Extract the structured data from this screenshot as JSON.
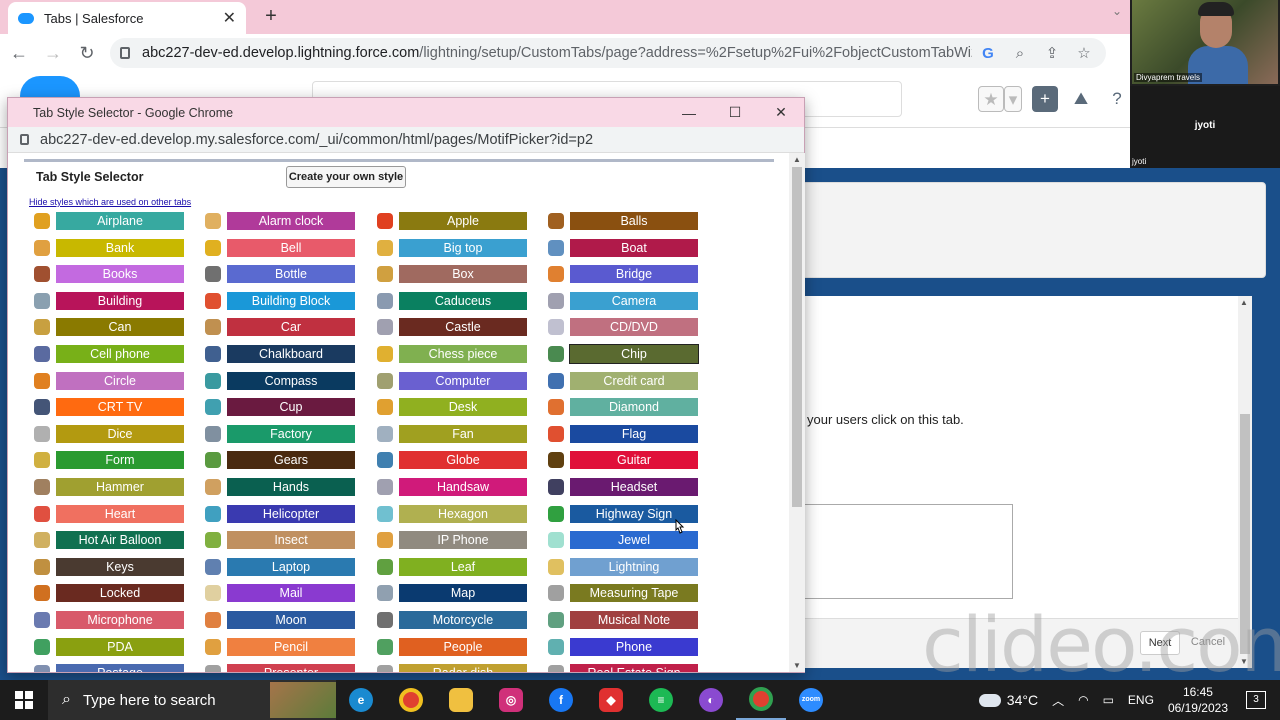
{
  "main_browser": {
    "tab_title": "Tabs | Salesforce",
    "url_host": "abc227-dev-ed.develop.lightning.force.com",
    "url_path": "/lightning/setup/CustomTabs/page?address=%2Fsetup%2Fui%2FobjectCustomTabWizard..."
  },
  "salesforce_page": {
    "help_text": "your users click on this tab.",
    "next_label": "Next",
    "cancel_label": "Cancel"
  },
  "zoom": {
    "participant_1": "Divyaprem travels",
    "participant_2": "jyoti",
    "participant_2_label": "jyoti"
  },
  "popup": {
    "window_title": "Tab Style Selector - Google Chrome",
    "url": "abc227-dev-ed.develop.my.salesforce.com/_ui/common/html/pages/MotifPicker?id=p2",
    "heading": "Tab Style Selector",
    "create_button": "Create your own style",
    "hide_link": "Hide styles which are used on other tabs",
    "selected_style": "Chip",
    "columns": [
      [
        {
          "label": "Airplane",
          "color": "#37a9a0",
          "icon_color": "#e0a020"
        },
        {
          "label": "Bank",
          "color": "#c8b800",
          "icon_color": "#e0a040"
        },
        {
          "label": "Books",
          "color": "#c36ae0",
          "icon_color": "#a05030"
        },
        {
          "label": "Building",
          "color": "#b8145a",
          "icon_color": "#8aa0b0"
        },
        {
          "label": "Can",
          "color": "#8a7a00",
          "icon_color": "#c8a040"
        },
        {
          "label": "Cell phone",
          "color": "#78b018",
          "icon_color": "#5a6aa0"
        },
        {
          "label": "Circle",
          "color": "#c070c0",
          "icon_color": "#e08020"
        },
        {
          "label": "CRT TV",
          "color": "#ff6a10",
          "icon_color": "#445577"
        },
        {
          "label": "Dice",
          "color": "#b39a10",
          "icon_color": "#b0b0b0"
        },
        {
          "label": "Form",
          "color": "#2a9a30",
          "icon_color": "#d0b040"
        },
        {
          "label": "Hammer",
          "color": "#a0a030",
          "icon_color": "#a08060"
        },
        {
          "label": "Heart",
          "color": "#f07060",
          "icon_color": "#e05040"
        },
        {
          "label": "Hot Air Balloon",
          "color": "#107050",
          "icon_color": "#d0b060"
        },
        {
          "label": "Keys",
          "color": "#4a3a30",
          "icon_color": "#c09040"
        },
        {
          "label": "Locked",
          "color": "#6a2a20",
          "icon_color": "#d07020"
        },
        {
          "label": "Microphone",
          "color": "#d85a6a",
          "icon_color": "#6a7ab0"
        },
        {
          "label": "PDA",
          "color": "#8aa010",
          "icon_color": "#40a060"
        },
        {
          "label": "Postage",
          "color": "#4a6ab0",
          "icon_color": "#8090b0"
        }
      ],
      [
        {
          "label": "Alarm clock",
          "color": "#b03a9a",
          "icon_color": "#e0b060"
        },
        {
          "label": "Bell",
          "color": "#e85a6a",
          "icon_color": "#e0b020"
        },
        {
          "label": "Bottle",
          "color": "#5a6ad0",
          "icon_color": "#707070"
        },
        {
          "label": "Building Block",
          "color": "#1a98d8",
          "icon_color": "#e05030"
        },
        {
          "label": "Car",
          "color": "#c03040",
          "icon_color": "#c09050"
        },
        {
          "label": "Chalkboard",
          "color": "#1a3a60",
          "icon_color": "#406090"
        },
        {
          "label": "Compass",
          "color": "#0a3a60",
          "icon_color": "#3a9aa0"
        },
        {
          "label": "Cup",
          "color": "#6a1a40",
          "icon_color": "#40a0b0"
        },
        {
          "label": "Factory",
          "color": "#1a9a6a",
          "icon_color": "#8090a0"
        },
        {
          "label": "Gears",
          "color": "#4a2a10",
          "icon_color": "#5a9a40"
        },
        {
          "label": "Hands",
          "color": "#0a6050",
          "icon_color": "#d0a060"
        },
        {
          "label": "Helicopter",
          "color": "#3a3ab0",
          "icon_color": "#40a0c0"
        },
        {
          "label": "Insect",
          "color": "#c09060",
          "icon_color": "#80b040"
        },
        {
          "label": "Laptop",
          "color": "#2a7ab0",
          "icon_color": "#6080b0"
        },
        {
          "label": "Mail",
          "color": "#8a3ad0",
          "icon_color": "#e0d0a0"
        },
        {
          "label": "Moon",
          "color": "#2a5aa0",
          "icon_color": "#e08040"
        },
        {
          "label": "Pencil",
          "color": "#f08040",
          "icon_color": "#e0a040"
        },
        {
          "label": "Presenter",
          "color": "#d04050",
          "icon_color": "#a0a0a0"
        }
      ],
      [
        {
          "label": "Apple",
          "color": "#8a7a10",
          "icon_color": "#e04020"
        },
        {
          "label": "Big top",
          "color": "#3aa0d0",
          "icon_color": "#e0b040"
        },
        {
          "label": "Box",
          "color": "#a06a60",
          "icon_color": "#d0a040"
        },
        {
          "label": "Caduceus",
          "color": "#0a8060",
          "icon_color": "#8a9ab0"
        },
        {
          "label": "Castle",
          "color": "#6a2a20",
          "icon_color": "#a0a0b0"
        },
        {
          "label": "Chess piece",
          "color": "#80b050",
          "icon_color": "#e0b030"
        },
        {
          "label": "Computer",
          "color": "#6a60d0",
          "icon_color": "#a0a070"
        },
        {
          "label": "Desk",
          "color": "#90b020",
          "icon_color": "#e0a030"
        },
        {
          "label": "Fan",
          "color": "#a0a020",
          "icon_color": "#a0b0c0"
        },
        {
          "label": "Globe",
          "color": "#e03030",
          "icon_color": "#4080b0"
        },
        {
          "label": "Handsaw",
          "color": "#d01a7a",
          "icon_color": "#a0a0b0"
        },
        {
          "label": "Hexagon",
          "color": "#b0b050",
          "icon_color": "#70c0d0"
        },
        {
          "label": "IP Phone",
          "color": "#908a80",
          "icon_color": "#e0a040"
        },
        {
          "label": "Leaf",
          "color": "#80b020",
          "icon_color": "#60a040"
        },
        {
          "label": "Map",
          "color": "#0a3a70",
          "icon_color": "#90a0b0"
        },
        {
          "label": "Motorcycle",
          "color": "#2a6a9a",
          "icon_color": "#707070"
        },
        {
          "label": "People",
          "color": "#e06020",
          "icon_color": "#50a060"
        },
        {
          "label": "Radar dish",
          "color": "#c0a030",
          "icon_color": "#a0a0a0"
        }
      ],
      [
        {
          "label": "Balls",
          "color": "#8a5010",
          "icon_color": "#a06020"
        },
        {
          "label": "Boat",
          "color": "#b01a4a",
          "icon_color": "#6090c0"
        },
        {
          "label": "Bridge",
          "color": "#5a5ad0",
          "icon_color": "#e08030"
        },
        {
          "label": "Camera",
          "color": "#3aa0d0",
          "icon_color": "#a0a0b0"
        },
        {
          "label": "CD/DVD",
          "color": "#c07080",
          "icon_color": "#c0c0d0"
        },
        {
          "label": "Chip",
          "color": "#5a6a30",
          "icon_color": "#4a8a50"
        },
        {
          "label": "Credit card",
          "color": "#a0b070",
          "icon_color": "#4070b0"
        },
        {
          "label": "Diamond",
          "color": "#60b0a0",
          "icon_color": "#e07030"
        },
        {
          "label": "Flag",
          "color": "#1a4aa0",
          "icon_color": "#e05030"
        },
        {
          "label": "Guitar",
          "color": "#e0103a",
          "icon_color": "#604010"
        },
        {
          "label": "Headset",
          "color": "#6a1a70",
          "icon_color": "#404060"
        },
        {
          "label": "Highway Sign",
          "color": "#1a5aa0",
          "icon_color": "#30a040"
        },
        {
          "label": "Jewel",
          "color": "#2a6ad0",
          "icon_color": "#a0e0d0"
        },
        {
          "label": "Lightning",
          "color": "#70a0d0",
          "icon_color": "#e0c060"
        },
        {
          "label": "Measuring Tape",
          "color": "#7a7a20",
          "icon_color": "#a0a0a0"
        },
        {
          "label": "Musical Note",
          "color": "#a04040",
          "icon_color": "#60a080"
        },
        {
          "label": "Phone",
          "color": "#3a3ad0",
          "icon_color": "#60b0b0"
        },
        {
          "label": "Real Estate Sign",
          "color": "#c0204a",
          "icon_color": "#a0a0a0"
        }
      ]
    ]
  },
  "watermark": "clideo.com",
  "taskbar": {
    "search_placeholder": "Type here to search",
    "temperature": "34°C",
    "language": "ENG",
    "time": "16:45",
    "date": "06/19/2023",
    "notification_count": "3"
  }
}
